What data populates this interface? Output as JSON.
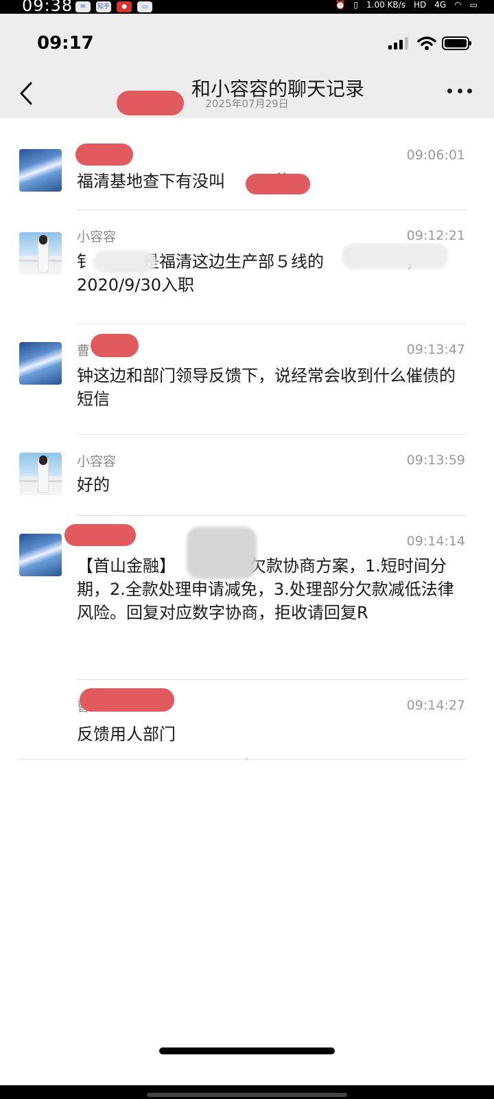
{
  "outer_status": {
    "time": "09:38",
    "icon_zhihu": "知乎",
    "network_speed": "1.00 KB/s",
    "hd_label": "HD",
    "cell_label": "4G"
  },
  "status_bar": {
    "time": "09:17"
  },
  "header": {
    "title_visible": "和小容容的聊天记录",
    "date": "2025年07月29日"
  },
  "messages": [
    {
      "sender": "",
      "time": "09:06:01",
      "text": "福清基地查下有没叫　　　的"
    },
    {
      "sender": "小容容",
      "time": "09:12:21",
      "text": "钅　　　是福清这边生产部５线的　　　　　，\n2020/9/30入职"
    },
    {
      "sender": "曹",
      "time": "09:13:47",
      "text": "钟这边和部门领导反馈下，说经常会收到什么催债的短信"
    },
    {
      "sender": "小容容",
      "time": "09:13:59",
      "text": "好的"
    },
    {
      "sender": "",
      "time": "09:14:14",
      "text": "【首山金融】　　　　　欠款协商方案，1.短时间分期，2.全款处理申请减免，3.处理部分欠款减低法律风险。回复对应数字协商，拒收请回复R"
    },
    {
      "sender": "曹",
      "time": "09:14:27",
      "text": "反馈用人部门"
    }
  ],
  "colors": {
    "header_bg": "#ededed",
    "redaction": "#e05a5e",
    "text": "#1a1a1a",
    "meta": "#8a8a8a"
  },
  "icons": [
    "back-arrow-icon",
    "more-icon",
    "signal-icon",
    "wifi-icon",
    "battery-icon"
  ]
}
